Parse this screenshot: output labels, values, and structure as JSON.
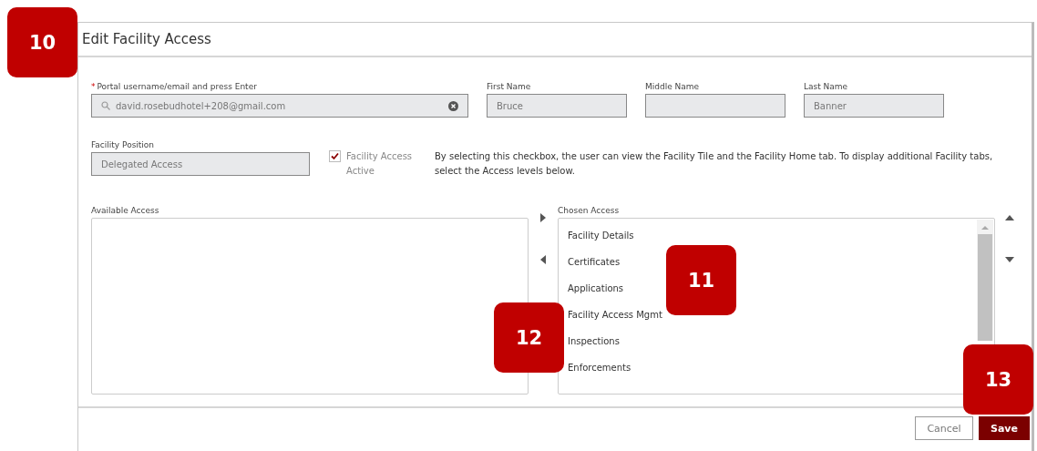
{
  "dialog": {
    "title": "Edit Facility Access"
  },
  "user_fields": [
    {
      "label": "Portal username/email and press Enter",
      "required_mark": "*",
      "kind": "search",
      "value": "david.rosebudhotel+208@gmail.com"
    },
    {
      "label": "First Name",
      "kind": "text",
      "value": "Bruce"
    },
    {
      "label": "Middle Name",
      "kind": "text"
    },
    {
      "label": "Last Name",
      "kind": "text",
      "value": "Banner"
    }
  ],
  "position": {
    "label": "Facility Position",
    "value": "Delegated Access"
  },
  "access_active": {
    "label": "Facility Access Active",
    "checked": true
  },
  "help_text": "By selecting this checkbox, the user can view the Facility Tile and the Facility Home tab. To display additional Facility tabs, select the Access levels below.",
  "available_access": {
    "label": "Available Access"
  },
  "chosen_access": {
    "label": "Chosen Access",
    "items": [
      "Facility Details",
      "Certificates",
      "Applications",
      "Facility Access Mgmt",
      "Inspections",
      "Enforcements"
    ]
  },
  "buttons": [
    {
      "label": "Cancel",
      "kind": "secondary"
    },
    {
      "label": "Save",
      "kind": "primary"
    }
  ],
  "callouts": [
    "10",
    "11",
    "12",
    "13"
  ]
}
